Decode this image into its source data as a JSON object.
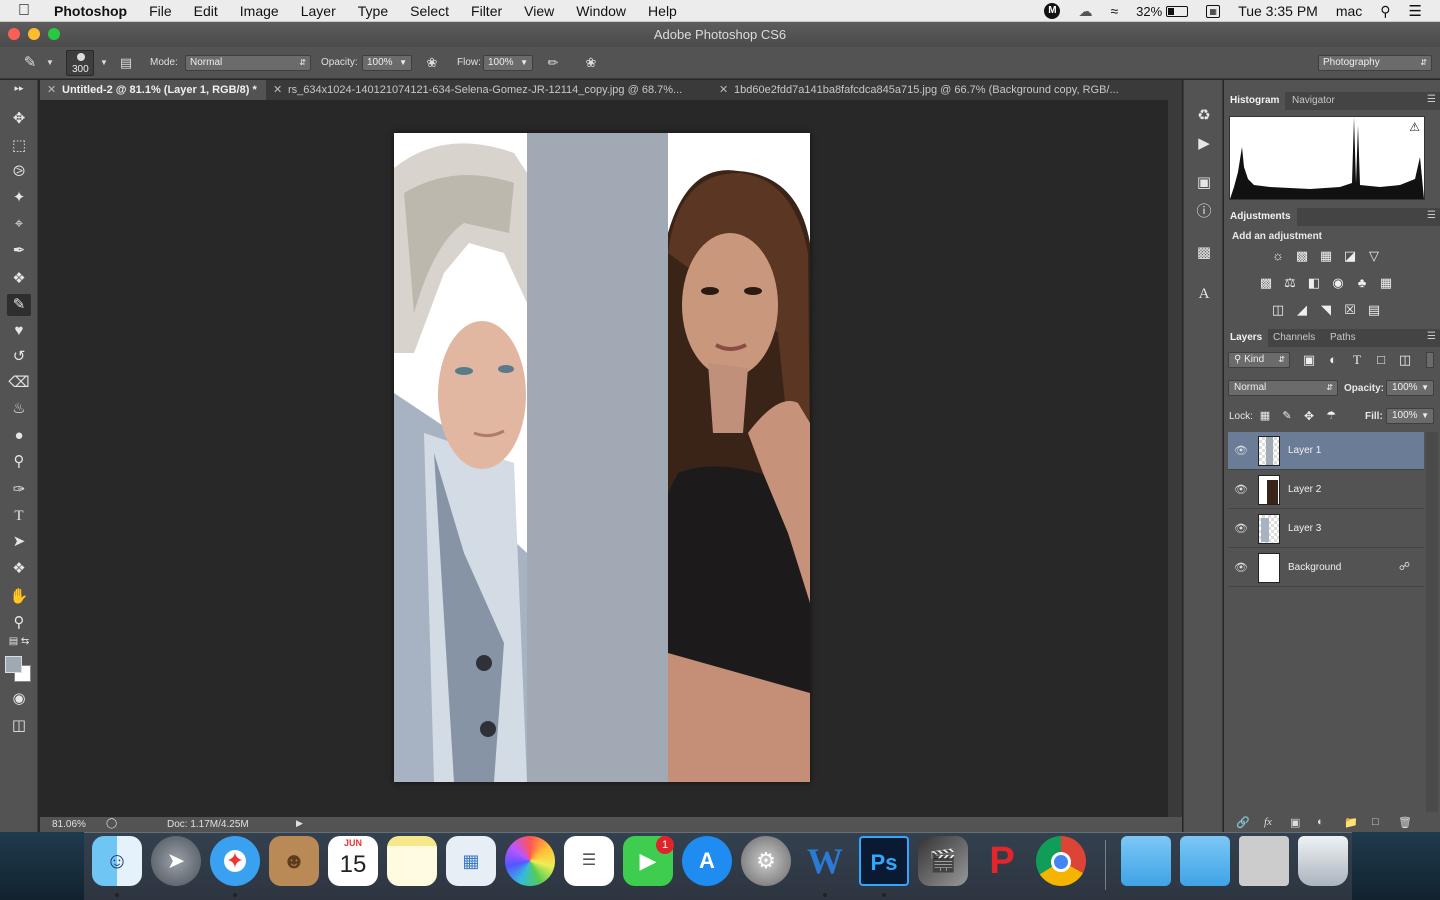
{
  "menubar": {
    "app_name": "Photoshop",
    "items": [
      "File",
      "Edit",
      "Image",
      "Layer",
      "Type",
      "Select",
      "Filter",
      "View",
      "Window",
      "Help"
    ],
    "battery": "32%",
    "clock": "Tue 3:35 PM",
    "user": "mac"
  },
  "window": {
    "title": "Adobe Photoshop CS6"
  },
  "options": {
    "brush_size": "300",
    "mode_label": "Mode:",
    "mode_value": "Normal",
    "opacity_label": "Opacity:",
    "opacity_value": "100%",
    "flow_label": "Flow:",
    "flow_value": "100%",
    "workspace": "Photography"
  },
  "tabs": [
    {
      "label": "Untitled-2 @ 81.1% (Layer 1, RGB/8) *",
      "active": true
    },
    {
      "label": "rs_634x1024-140121074121-634-Selena-Gomez-JR-12114_copy.jpg @ 68.7%...",
      "active": false
    },
    {
      "label": "1bd60e2fdd7a141ba8fafcdca845a715.jpg @ 66.7% (Background copy, RGB/...",
      "active": false
    }
  ],
  "status": {
    "zoom": "81.06%",
    "doc": "Doc: 1.17M/4.25M"
  },
  "panels": {
    "histogram_tab": "Histogram",
    "navigator_tab": "Navigator",
    "adjustments_tab": "Adjustments",
    "add_adjustment": "Add an adjustment",
    "layers_tab": "Layers",
    "channels_tab": "Channels",
    "paths_tab": "Paths",
    "kind_filter": "Kind",
    "blend_mode": "Normal",
    "opacity_label": "Opacity:",
    "opacity_value": "100%",
    "lock_label": "Lock:",
    "fill_label": "Fill:",
    "fill_value": "100%",
    "layers": [
      {
        "name": "Layer 1",
        "active": true
      },
      {
        "name": "Layer 2",
        "active": false
      },
      {
        "name": "Layer 3",
        "active": false
      },
      {
        "name": "Background",
        "active": false,
        "locked": true
      }
    ]
  },
  "dock": {
    "calendar_month": "JUN",
    "calendar_day": "15",
    "facetime_badge": "1",
    "apps": [
      "Finder",
      "Launchpad",
      "Safari",
      "Contacts",
      "Calendar",
      "Notes",
      "Preview",
      "Photos",
      "Reminders",
      "FaceTime",
      "App Store",
      "System Preferences",
      "Word",
      "Photoshop",
      "Final Cut Pro",
      "Polaris Office",
      "Chrome",
      "Folder",
      "Folder",
      "Screenshots",
      "Trash"
    ]
  }
}
